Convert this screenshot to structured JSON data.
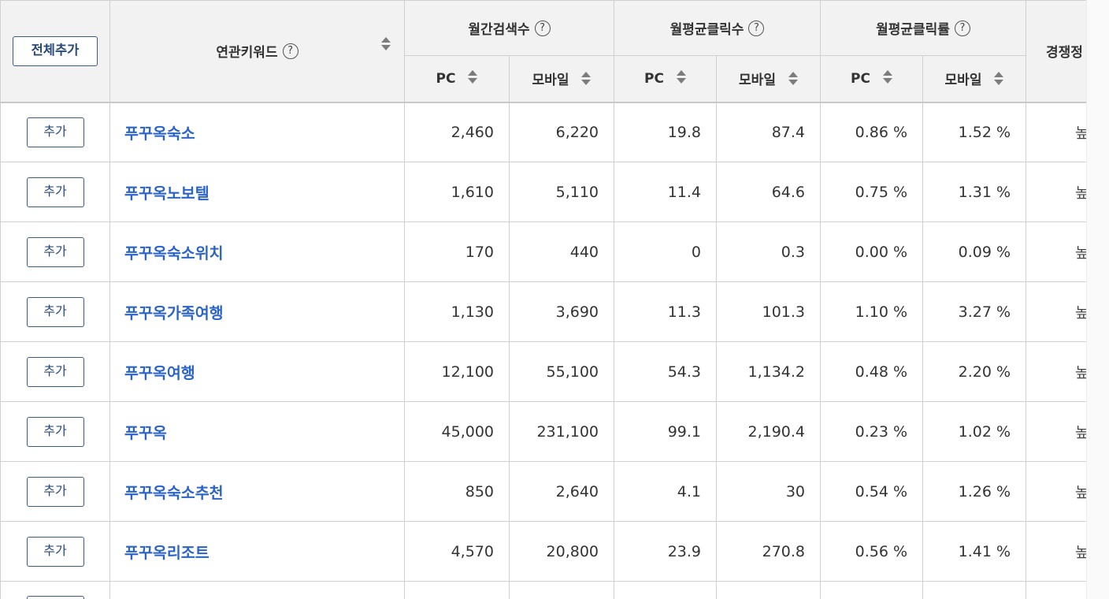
{
  "header": {
    "add_all_label": "전체추가",
    "keyword_label": "연관키워드",
    "monthly_search_label": "월간검색수",
    "avg_clicks_label": "월평균클릭수",
    "avg_ctr_label": "월평균클릭률",
    "competition_label": "경쟁정",
    "pc_label": "PC",
    "mobile_label": "모바일",
    "help_glyph": "?"
  },
  "row_add_label": "추가",
  "rows": [
    {
      "keyword": "푸꾸옥숙소",
      "search_pc": "2,460",
      "search_mobile": "6,220",
      "clicks_pc": "19.8",
      "clicks_mobile": "87.4",
      "ctr_pc": "0.86 %",
      "ctr_mobile": "1.52 %",
      "competition": "높"
    },
    {
      "keyword": "푸꾸옥노보텔",
      "search_pc": "1,610",
      "search_mobile": "5,110",
      "clicks_pc": "11.4",
      "clicks_mobile": "64.6",
      "ctr_pc": "0.75 %",
      "ctr_mobile": "1.31 %",
      "competition": "높"
    },
    {
      "keyword": "푸꾸옥숙소위치",
      "search_pc": "170",
      "search_mobile": "440",
      "clicks_pc": "0",
      "clicks_mobile": "0.3",
      "ctr_pc": "0.00 %",
      "ctr_mobile": "0.09 %",
      "competition": "높"
    },
    {
      "keyword": "푸꾸옥가족여행",
      "search_pc": "1,130",
      "search_mobile": "3,690",
      "clicks_pc": "11.3",
      "clicks_mobile": "101.3",
      "ctr_pc": "1.10 %",
      "ctr_mobile": "3.27 %",
      "competition": "높"
    },
    {
      "keyword": "푸꾸옥여행",
      "search_pc": "12,100",
      "search_mobile": "55,100",
      "clicks_pc": "54.3",
      "clicks_mobile": "1,134.2",
      "ctr_pc": "0.48 %",
      "ctr_mobile": "2.20 %",
      "competition": "높"
    },
    {
      "keyword": "푸꾸옥",
      "search_pc": "45,000",
      "search_mobile": "231,100",
      "clicks_pc": "99.1",
      "clicks_mobile": "2,190.4",
      "ctr_pc": "0.23 %",
      "ctr_mobile": "1.02 %",
      "competition": "높"
    },
    {
      "keyword": "푸꾸옥숙소추천",
      "search_pc": "850",
      "search_mobile": "2,640",
      "clicks_pc": "4.1",
      "clicks_mobile": "30",
      "ctr_pc": "0.54 %",
      "ctr_mobile": "1.26 %",
      "competition": "높"
    },
    {
      "keyword": "푸꾸옥리조트",
      "search_pc": "4,570",
      "search_mobile": "20,800",
      "clicks_pc": "23.9",
      "clicks_mobile": "270.8",
      "ctr_pc": "0.56 %",
      "ctr_mobile": "1.41 %",
      "competition": "높"
    },
    {
      "keyword": "",
      "search_pc": "",
      "search_mobile": "",
      "clicks_pc": "",
      "clicks_mobile": "",
      "ctr_pc": "",
      "ctr_mobile": "",
      "competition": ""
    }
  ]
}
